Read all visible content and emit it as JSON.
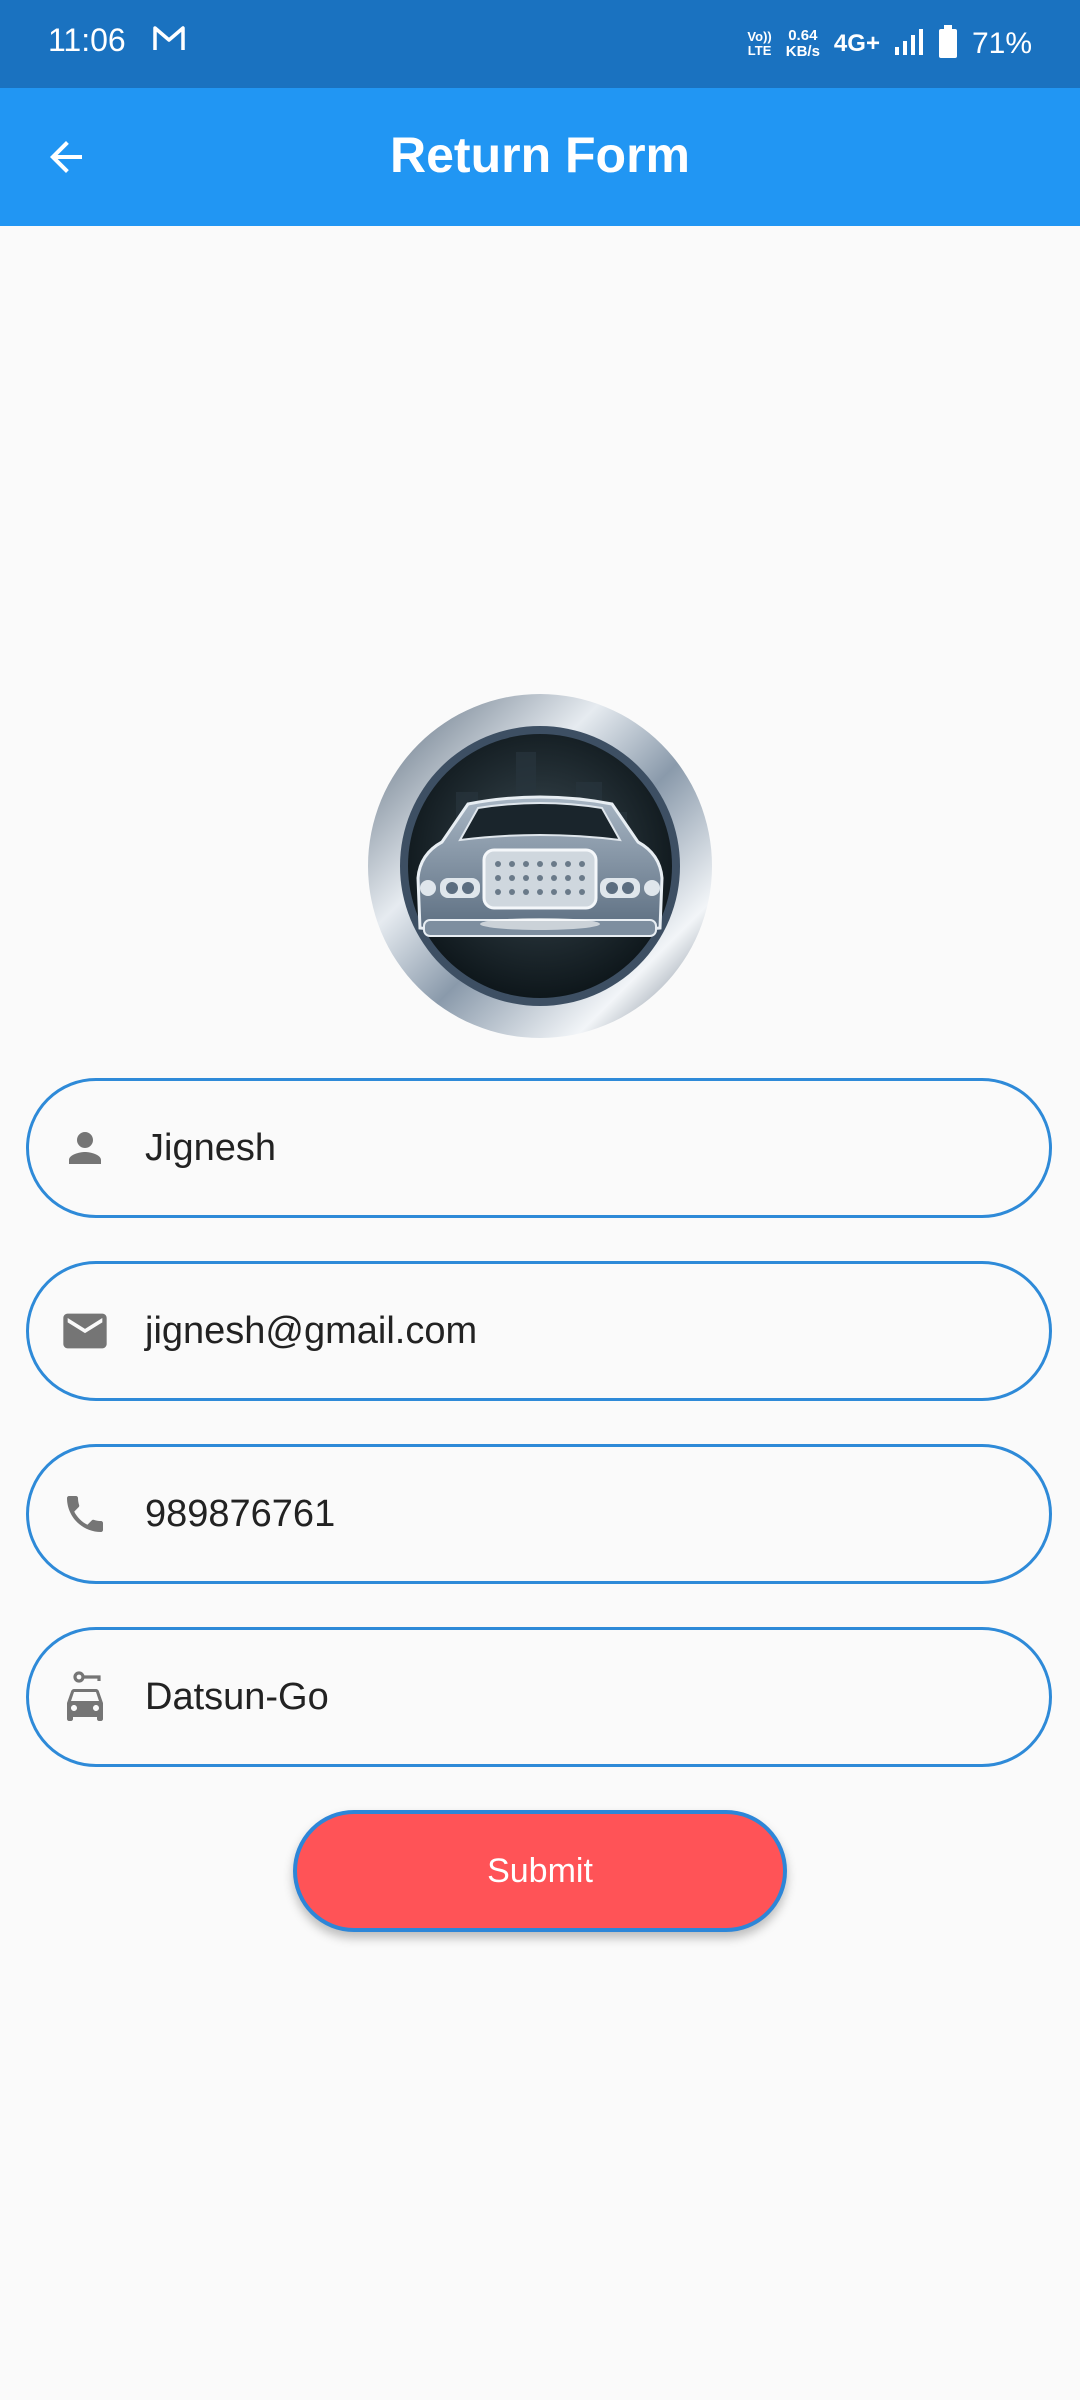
{
  "status_bar": {
    "time": "11:06",
    "volte_line1": "Vo))",
    "volte_line2": "LTE",
    "speed_value": "0.64",
    "speed_unit": "KB/s",
    "network": "4G+",
    "battery": "71%"
  },
  "app_bar": {
    "title": "Return Form",
    "back_icon": "arrow-back-icon"
  },
  "form": {
    "name": {
      "value": "Jignesh",
      "icon": "person-icon"
    },
    "email": {
      "value": "jignesh@gmail.com",
      "icon": "mail-icon"
    },
    "phone": {
      "value": "989876761",
      "icon": "phone-icon"
    },
    "car": {
      "value": "Datsun-Go",
      "icon": "car-rental-icon"
    }
  },
  "submit_label": "Submit",
  "colors": {
    "status_bar": "#1a72c0",
    "app_bar": "#2196f3",
    "field_border": "#2e8ad8",
    "submit": "#ff5357",
    "icon_gray": "#757575"
  }
}
